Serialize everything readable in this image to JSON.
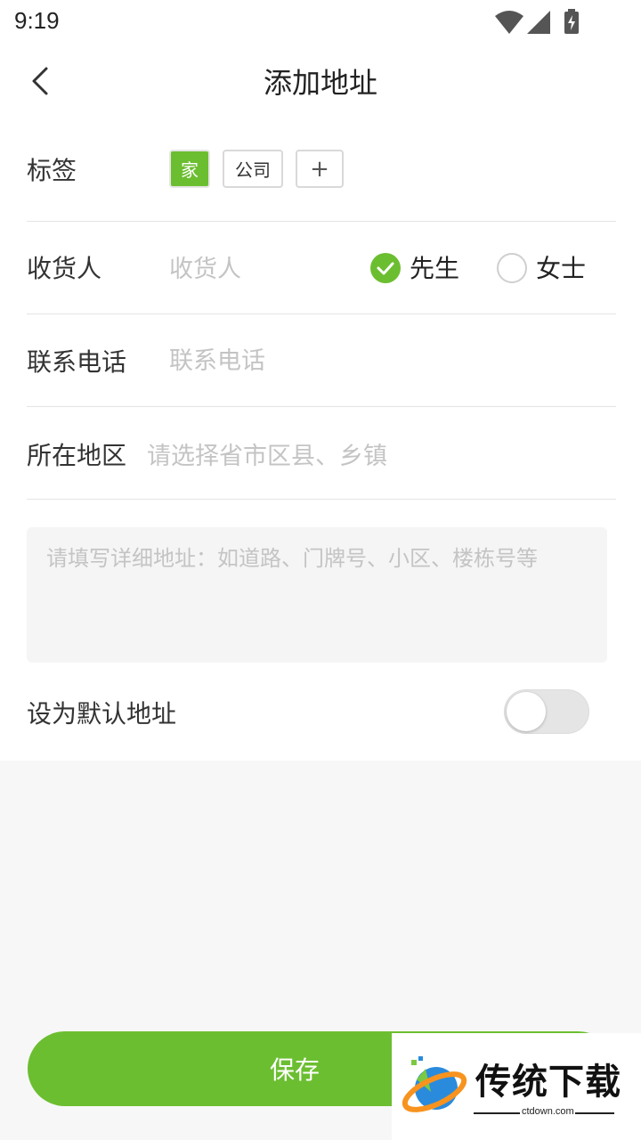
{
  "status_bar": {
    "time": "9:19"
  },
  "header": {
    "title": "添加地址"
  },
  "form": {
    "tag": {
      "label": "标签",
      "options": [
        "家",
        "公司"
      ],
      "selected": "家",
      "add_symbol": "+"
    },
    "receiver": {
      "label": "收货人",
      "placeholder": "收货人",
      "gender_options": [
        "先生",
        "女士"
      ],
      "gender_selected": "先生"
    },
    "phone": {
      "label": "联系电话",
      "placeholder": "联系电话"
    },
    "region": {
      "label": "所在地区",
      "placeholder": "请选择省市区县、乡镇"
    },
    "address_detail": {
      "placeholder": "请填写详细地址：如道路、门牌号、小区、楼栋号等"
    },
    "default_address": {
      "label": "设为默认地址",
      "enabled": false
    }
  },
  "save_button": {
    "label": "保存"
  },
  "watermark": {
    "text": "传统下载",
    "url": "ctdown.com"
  },
  "colors": {
    "accent": "#6cbe31",
    "placeholder": "#c4c4c4",
    "divider": "#e4e4e4",
    "background": "#f7f7f7"
  }
}
